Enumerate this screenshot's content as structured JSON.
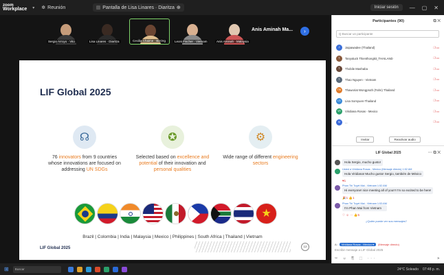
{
  "titlebar": {
    "logo_line1": "zoom",
    "logo_line2": "Workplace",
    "meeting_label": "Reunión",
    "share_label": "Pantalla de Lisa Linares · Diaritza",
    "signin_label": "Iniciar sesión",
    "minimize": "—",
    "maximize": "▢",
    "close": "✕"
  },
  "strip": {
    "tiles": [
      {
        "name": "Sergio Arroyo · Vito",
        "bg": "#8fa3a8"
      },
      {
        "name": "Lisa Linares · Diaritza",
        "bg": "#d9d4cf"
      },
      {
        "name": "Cecilia Chaime · BizOrg",
        "bg": "#cfd8da"
      },
      {
        "name": "Leoni Fischer · Vietnam",
        "bg": "#c8c0b2"
      },
      {
        "name": "Anis Aminah · Malaysia",
        "bg": "#a9b3b0"
      }
    ],
    "active_speaker": "Anis Aminah Ma...",
    "next_icon": "›"
  },
  "slide": {
    "title": "LIF Global 2025",
    "col1": {
      "pre": "76 ",
      "hl1": "innovators",
      "mid": " from 9 countries whose innovations are focused on addressing ",
      "hl2": "UN SDGs",
      "post": ""
    },
    "col2": {
      "pre": "Selected based on ",
      "hl1": "excellence and potential",
      "mid": " of their innovation and ",
      "hl2": "personal qualities",
      "post": ""
    },
    "col3": {
      "pre": "Wide range of different ",
      "hl1": "engineering sectors",
      "mid": "",
      "hl2": "",
      "post": ""
    },
    "countries": "Brazil | Colombia | India | Malaysia | Mexico | Philippines | South Africa | Thailand | Vietnam",
    "footer_title": "LIF Global 2025",
    "page_number": "12"
  },
  "participants": {
    "title": "Participantes (90)",
    "search_placeholder": "Q Buscar un participante",
    "list": [
      {
        "name": "Jaipawadee (Thailand)",
        "initials": "J",
        "color": "#3b6fd8"
      },
      {
        "name": "Tanyaluck Thienthongkit_THAILAND",
        "initials": "T",
        "color": "#8a5a3c"
      },
      {
        "name": "Thobile Mashaba",
        "initials": "T",
        "color": "#6a4a3a"
      },
      {
        "name": "Thao Nguyen - Vietnam",
        "initials": "T",
        "color": "#5a6a7a"
      },
      {
        "name": "Thaworiat Wongpruth (Fahn) Thailand",
        "initials": "TW",
        "color": "#e07b2a"
      },
      {
        "name": "Lisa Somyuen-Thailand",
        "initials": "LS",
        "color": "#3a8ad8"
      },
      {
        "name": "Viridiana Rosas - Mexico",
        "initials": "VR",
        "color": "#2aa06a"
      },
      {
        "name": "...",
        "initials": "M",
        "color": "#3a6ad8"
      }
    ],
    "invite_label": "Invitar",
    "raise_label": "Reactivar audio"
  },
  "chat": {
    "title": "LIF Global 2025",
    "messages": [
      {
        "sender": "",
        "text": "Hola Sergio, mucho gusto!",
        "avatar": "#555"
      },
      {
        "sender": "Usted a Viridiana Rosas - Mexico (Mensaje directo) 1:52 AM",
        "text": "Hola Viridiana! Mucho gusto! Sergio, también de México",
        "avatar": "#2aa06a"
      },
      {
        "sender": "Phan Thi Tuyet Mai - Vietnam 1:52 AM",
        "text": "Hi everyone! nice meeting all of you!!! I'm so excited to be here!",
        "avatar": "#7a5aa8"
      },
      {
        "sender": "Phan Thi Tuyet Mai - Vietnam 1:53 AM",
        "text": "I'm Phan Mai from Vietnam",
        "avatar": "#7a5aa8"
      }
    ],
    "reaction1": "♥1",
    "reaction2": "🎉1  👍1",
    "reaction3": "♡ ☺ ···  👍5",
    "new_msgs": "¿Quién puede ver sus mensajes?",
    "to_label": "A:",
    "to_target": "Viridiana Rosas - Mexico ▾",
    "to_alert": "(Mensaje directo)",
    "input_placeholder": "Escribir mensaje a LIF Global 2025",
    "tools": "✂ ☺ ⎘ ⬚ ···",
    "send": "➤"
  },
  "taskbar": {
    "start": "⊞",
    "search_placeholder": "Buscar",
    "weather": "24°C Soleado",
    "clock": "07:48 p. m."
  }
}
